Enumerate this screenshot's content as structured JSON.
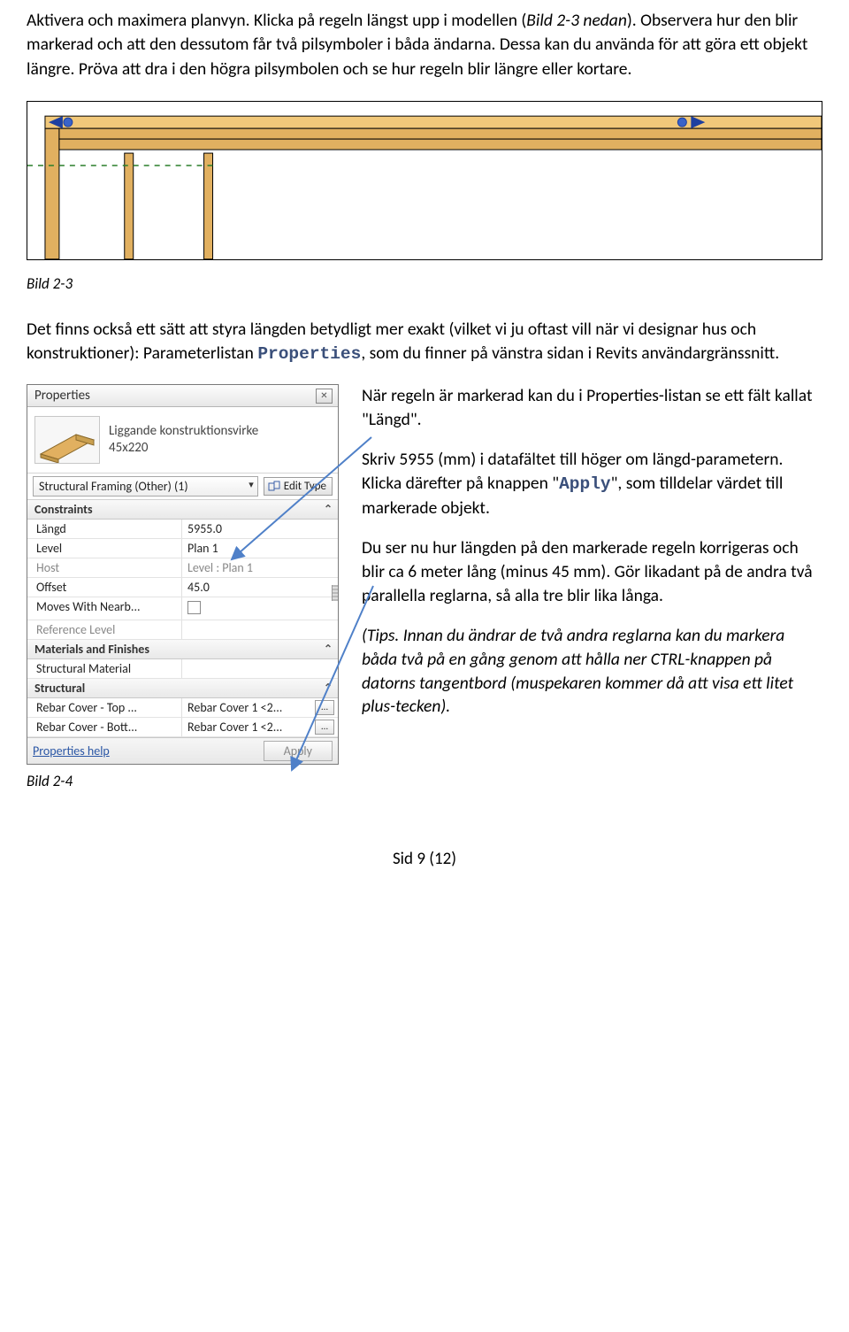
{
  "intro": {
    "p1a": "Aktivera och maximera planvyn. Klicka på regeln längst upp i modellen (",
    "p1_ref": "Bild 2-3 nedan",
    "p1b": "). Observera hur den blir markerad och att den dessutom får två pilsymboler i båda ändarna. Dessa kan du använda för att göra ett objekt längre. Pröva att dra i den högra pilsymbolen och se hur regeln blir längre eller kortare."
  },
  "captions": {
    "fig23": "Bild 2-3",
    "fig24": "Bild 2-4"
  },
  "middle": {
    "pre": "Det finns också ett sätt att styra längden betydligt mer exakt (vilket vi ju oftast vill när vi designar hus och konstruktioner): Parameterlistan ",
    "mono": "Properties",
    "post": ", som du finner på vänstra sidan i Revits användargränssnitt."
  },
  "right": {
    "p1": "När regeln är markerad kan du i Properties-listan se ett fält kallat \"Längd\".",
    "p2a": "Skriv 5955 (mm) i datafältet till höger om längd-parametern. Klicka därefter på knappen \"",
    "p2_mono": "Apply",
    "p2b": "\", som tilldelar värdet till markerade objekt.",
    "p3": "Du ser nu hur längden på den markerade regeln korrigeras och blir ca 6 meter lång (minus 45 mm). Gör likadant på de andra två parallella reglarna, så alla tre blir lika långa.",
    "p4": "(Tips. Innan du ändrar de två andra reglarna kan du markera båda två på en gång genom att hålla ner CTRL-knappen på datorns tangentbord (muspekaren kommer då att visa ett litet plus-tecken)."
  },
  "panel": {
    "title": "Properties",
    "type_line1": "Liggande konstruktionsvirke",
    "type_line2": "45x220",
    "category": "Structural Framing (Other) (1)",
    "edit_type": "Edit Type",
    "groups": {
      "constraints": "Constraints",
      "materials": "Materials and Finishes",
      "structural": "Structural"
    },
    "rows": {
      "langd_k": "Längd",
      "langd_v": "5955.0",
      "level_k": "Level",
      "level_v": "Plan 1",
      "host_k": "Host",
      "host_v": "Level : Plan 1",
      "offset_k": "Offset",
      "offset_v": "45.0",
      "moves_k": "Moves With Nearb...",
      "ref_k": "Reference Level",
      "smat_k": "Structural Material",
      "rct_k": "Rebar Cover - Top ...",
      "rct_v": "Rebar Cover 1 <2...",
      "rcb_k": "Rebar Cover - Bott...",
      "rcb_v": "Rebar Cover 1 <2..."
    },
    "help": "Properties help",
    "apply": "Apply"
  },
  "footer": "Sid 9 (12)"
}
